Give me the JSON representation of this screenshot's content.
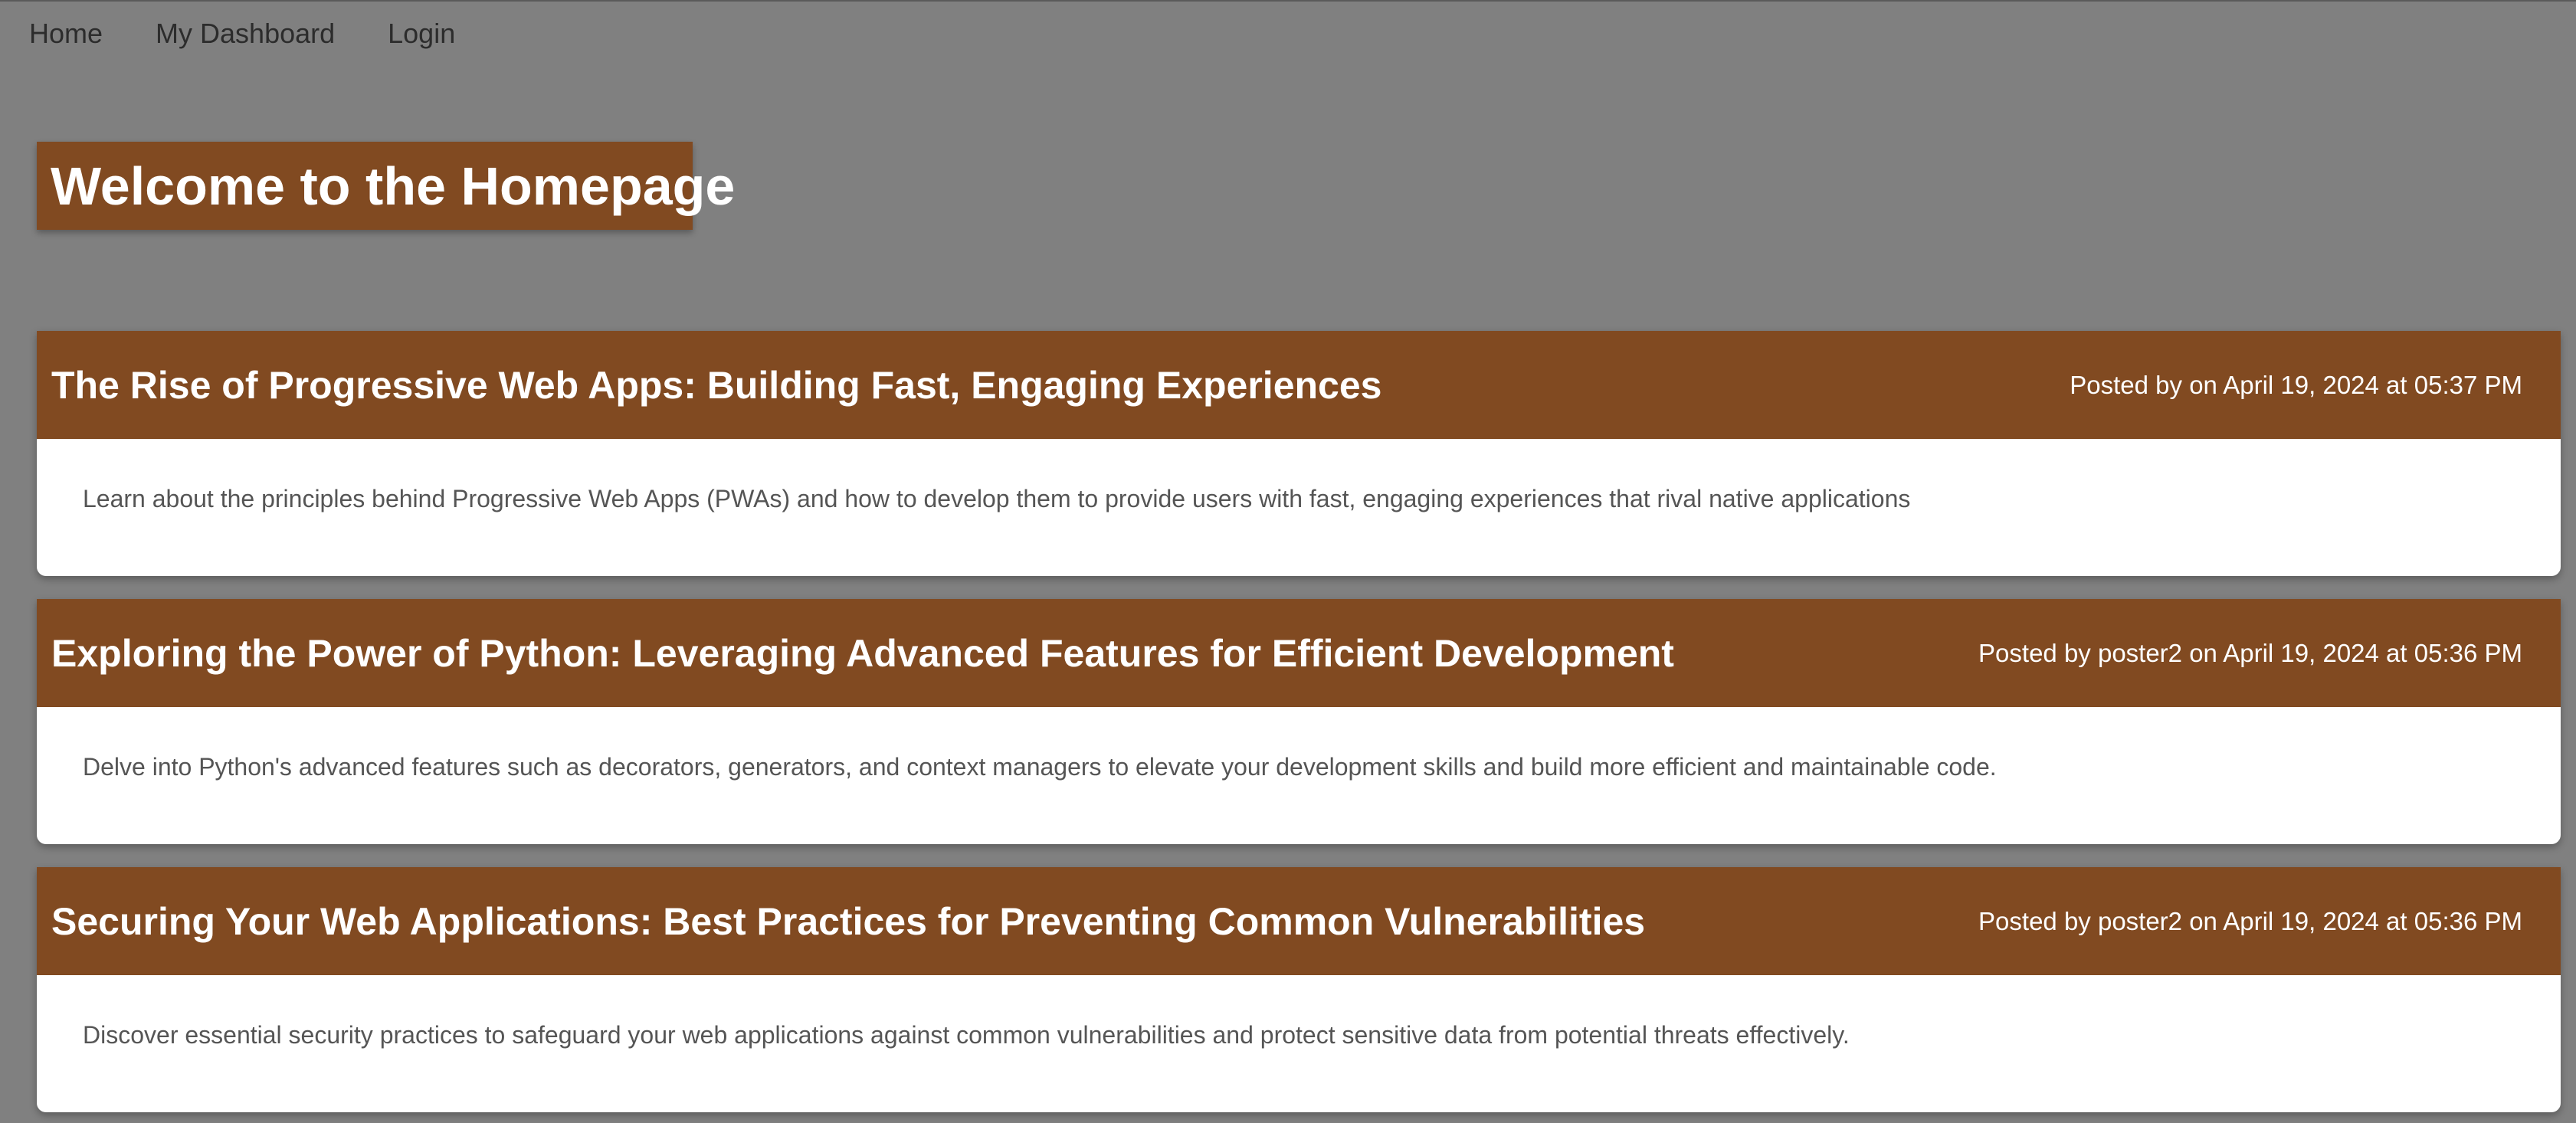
{
  "nav": {
    "items": [
      {
        "label": "Home"
      },
      {
        "label": "My Dashboard"
      },
      {
        "label": "Login"
      }
    ]
  },
  "page": {
    "title": "Welcome to the Homepage"
  },
  "posts": [
    {
      "title": "The Rise of Progressive Web Apps: Building Fast, Engaging Experiences",
      "meta": "Posted by on April 19, 2024 at 05:37 PM",
      "summary": "Learn about the principles behind Progressive Web Apps (PWAs) and how to develop them to provide users with fast, engaging experiences that rival native applications"
    },
    {
      "title": "Exploring the Power of Python: Leveraging Advanced Features for Efficient Development",
      "meta": "Posted by poster2 on April 19, 2024 at 05:36 PM",
      "summary": "Delve into Python's advanced features such as decorators, generators, and context managers to elevate your development skills and build more efficient and maintainable code."
    },
    {
      "title": "Securing Your Web Applications: Best Practices for Preventing Common Vulnerabilities",
      "meta": "Posted by poster2 on April 19, 2024 at 05:36 PM",
      "summary": "Discover essential security practices to safeguard your web applications against common vulnerabilities and protect sensitive data from potential threats effectively."
    }
  ],
  "colors": {
    "background": "#808080",
    "accent": "#814a21",
    "card": "#ffffff",
    "body_text": "#555555"
  }
}
